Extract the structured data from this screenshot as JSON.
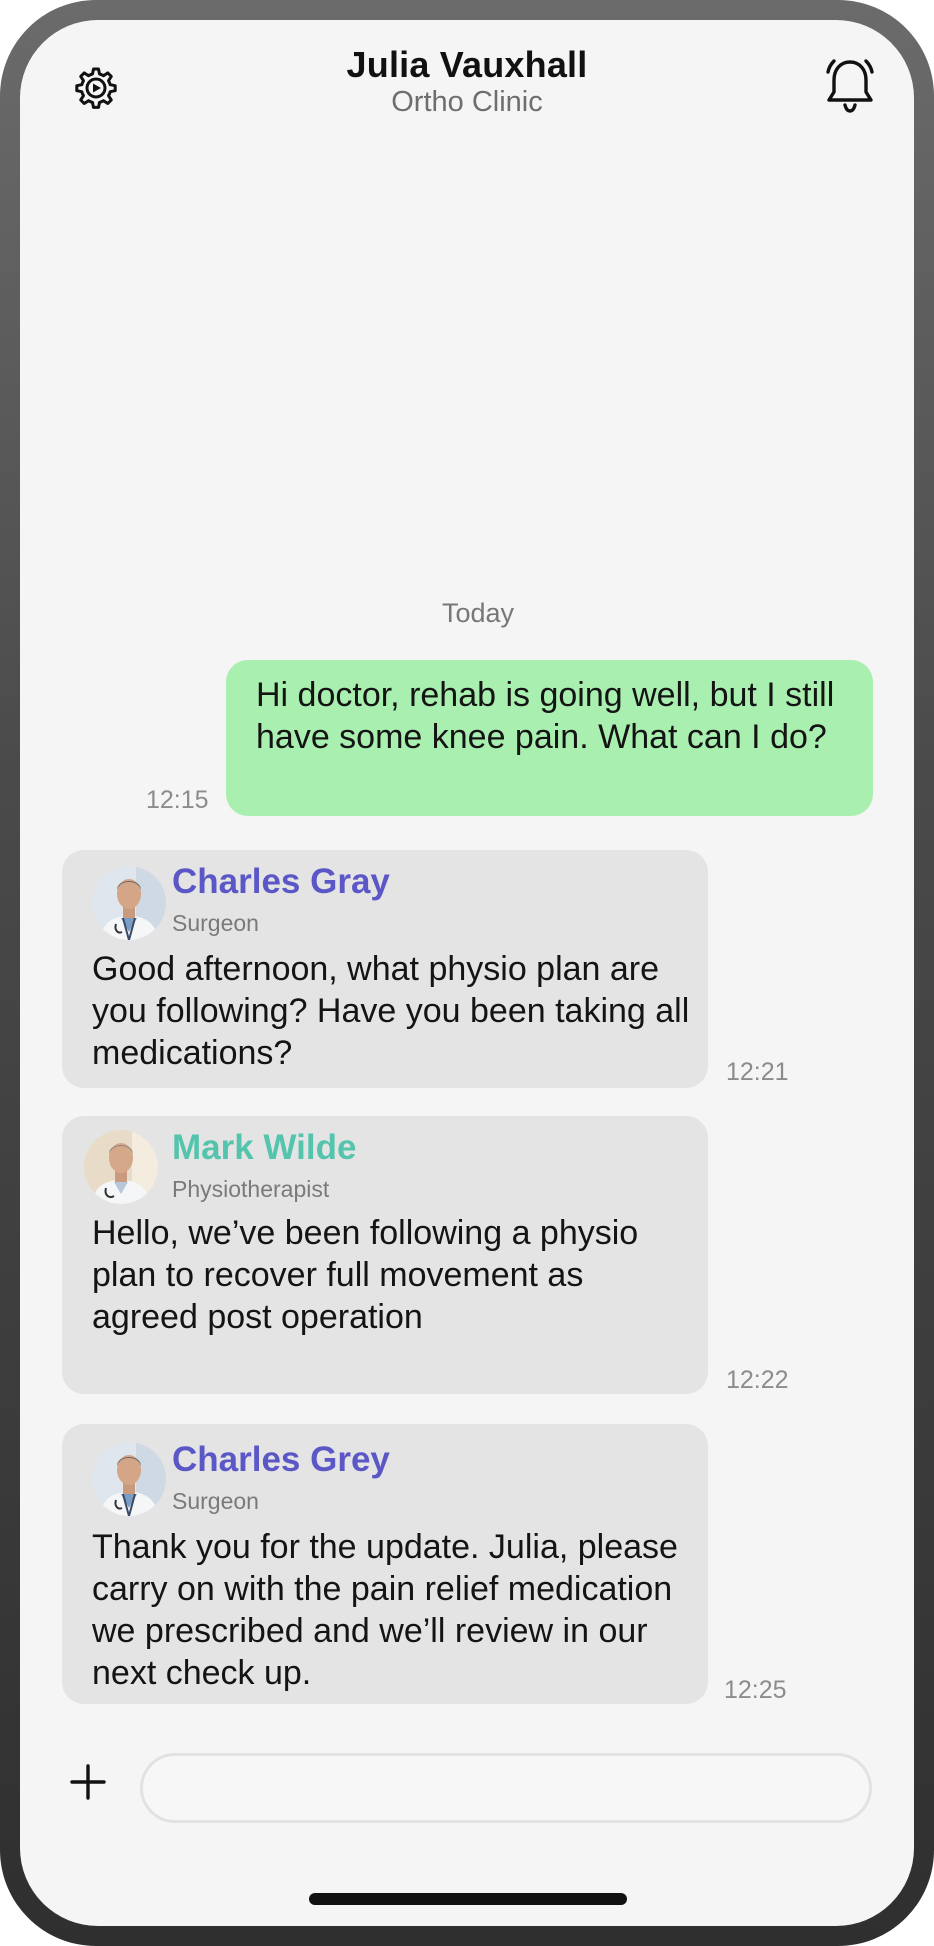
{
  "header": {
    "title": "Julia Vauxhall",
    "subtitle": "Ortho Clinic",
    "settings_icon": "gear-icon",
    "notifications_icon": "bell-icon"
  },
  "chat": {
    "date_separator": "Today",
    "messages": [
      {
        "direction": "outgoing",
        "text": "Hi doctor, rehab is going well, but I still have some knee pain. What can I do?",
        "time": "12:15"
      },
      {
        "direction": "incoming",
        "sender": "Charles Gray",
        "role": "Surgeon",
        "text": "Good afternoon, what physio plan are you following? Have you been taking all medications?",
        "time": "12:21",
        "sender_color": "#5b57c7"
      },
      {
        "direction": "incoming",
        "sender": "Mark Wilde",
        "role": "Physiotherapist",
        "text": "Hello, we’ve been following a physio plan to recover full movement as agreed post operation",
        "time": "12:22",
        "sender_color": "#55c4ad"
      },
      {
        "direction": "incoming",
        "sender": "Charles Grey",
        "role": "Surgeon",
        "text": "Thank you for the update. Julia, please carry on with the pain relief medication we prescribed and we’ll review in our next check up.",
        "time": "12:25",
        "sender_color": "#5b57c7"
      }
    ]
  },
  "composer": {
    "add_icon": "plus-icon",
    "placeholder": ""
  },
  "colors": {
    "outgoing_bubble": "#a9efaf",
    "incoming_bubble": "#e4e4e4",
    "background": "#f5f5f5"
  }
}
